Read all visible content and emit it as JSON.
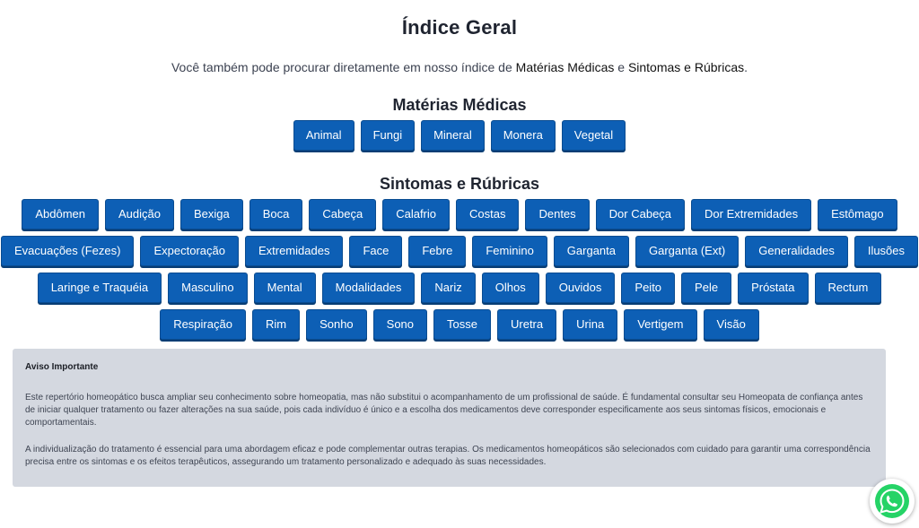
{
  "header": {
    "title": "Índice Geral"
  },
  "intro": {
    "text_before": "Você também pode procurar diretamente em nosso índice de ",
    "link_materias": "Matérias Médicas",
    "text_middle": " e ",
    "link_sintomas": "Sintomas e Rúbricas",
    "text_after": "."
  },
  "materias": {
    "title": "Matérias Médicas",
    "items": [
      "Animal",
      "Fungi",
      "Mineral",
      "Monera",
      "Vegetal"
    ]
  },
  "sintomas": {
    "title": "Sintomas e Rúbricas",
    "rows": [
      [
        "Abdômen",
        "Audição",
        "Bexiga",
        "Boca",
        "Cabeça",
        "Calafrio",
        "Costas",
        "Dentes",
        "Dor Cabeça",
        "Dor Extremidades",
        "Estômago"
      ],
      [
        "Evacuações (Fezes)",
        "Expectoração",
        "Extremidades",
        "Face",
        "Febre",
        "Feminino",
        "Garganta",
        "Garganta (Ext)",
        "Generalidades",
        "Ilusões"
      ],
      [
        "Laringe e Traquéia",
        "Masculino",
        "Mental",
        "Modalidades",
        "Nariz",
        "Olhos",
        "Ouvidos",
        "Peito",
        "Pele",
        "Próstata",
        "Rectum"
      ],
      [
        "Respiração",
        "Rim",
        "Sonho",
        "Sono",
        "Tosse",
        "Uretra",
        "Urina",
        "Vertigem",
        "Visão"
      ]
    ]
  },
  "notice": {
    "title": "Aviso Importante",
    "paragraph1": "Este repertório homeopático busca ampliar seu conhecimento sobre homeopatia, mas não substitui o acompanhamento de um profissional de saúde. É fundamental consultar seu Homeopata de confiança antes de iniciar qualquer tratamento ou fazer alterações na sua saúde, pois cada indivíduo é único e a escolha dos medicamentos deve corresponder especificamente aos seus sintomas físicos, emocionais e comportamentais.",
    "paragraph2": "A individualização do tratamento é essencial para uma abordagem eficaz e pode complementar outras terapias. Os medicamentos homeopáticos são selecionados com cuidado para garantir uma correspondência precisa entre os sintomas e os efeitos terapêuticos, assegurando um tratamento personalizado e adequado às suas necessidades."
  },
  "floating": {
    "icon": "whatsapp-icon",
    "color": "#25d366"
  },
  "colors": {
    "button_bg": "#0d5fb5",
    "button_text": "#ffffff",
    "notice_bg": "#d4d8e0"
  }
}
